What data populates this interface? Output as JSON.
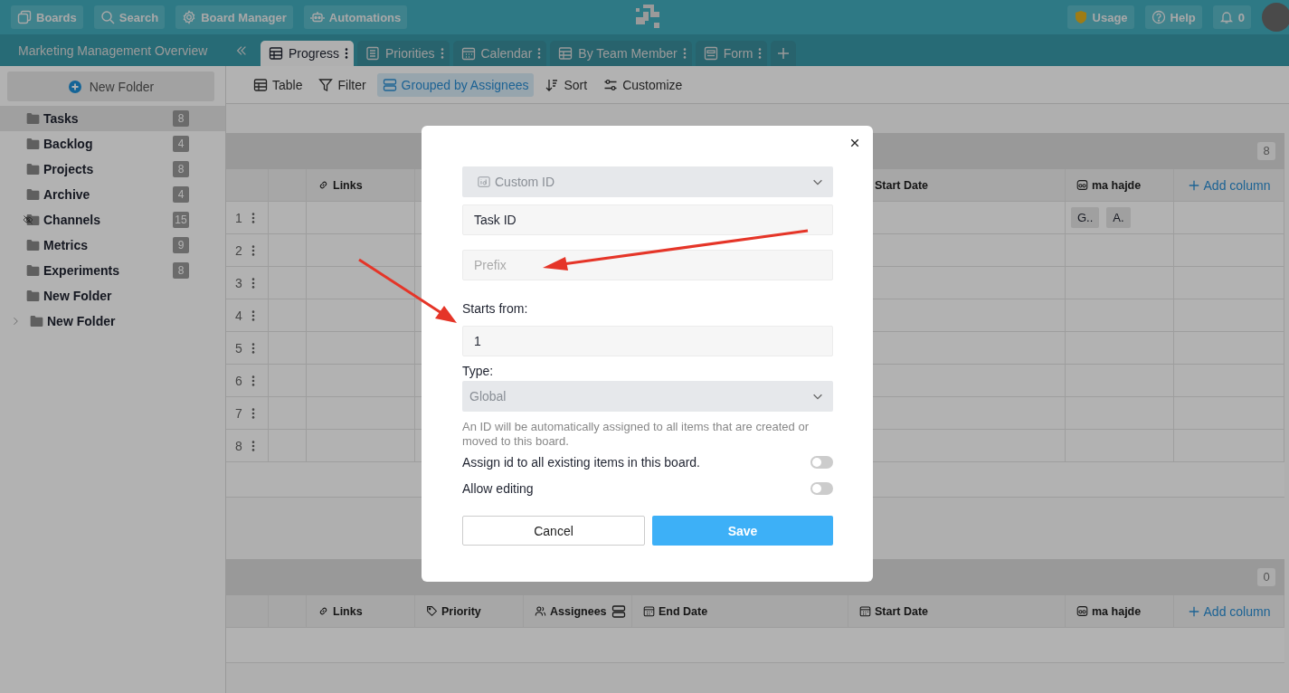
{
  "top_bar": {
    "nav": [
      {
        "kind": "boards",
        "label": "Boards"
      },
      {
        "kind": "search",
        "label": "Search"
      },
      {
        "kind": "gear",
        "label": "Board Manager"
      },
      {
        "kind": "robot",
        "label": "Automations"
      }
    ],
    "right": [
      {
        "kind": "shield",
        "label": "Usage"
      },
      {
        "kind": "help",
        "label": "Help"
      },
      {
        "kind": "bell",
        "label": "0"
      }
    ]
  },
  "board_title": "Marketing Management Overview",
  "tabs": [
    {
      "kind": "table",
      "label": "Progress",
      "selected": true
    },
    {
      "kind": "list",
      "label": "Priorities",
      "selected": false
    },
    {
      "kind": "calendar",
      "label": "Calendar",
      "selected": false
    },
    {
      "kind": "table",
      "label": "By Team Member",
      "selected": false
    },
    {
      "kind": "form",
      "label": "Form",
      "selected": false
    }
  ],
  "sidebar": {
    "new_folder": "New Folder",
    "items": [
      {
        "label": "Tasks",
        "count": "8",
        "selected": true,
        "hidden": false
      },
      {
        "label": "Backlog",
        "count": "4",
        "selected": false,
        "hidden": false
      },
      {
        "label": "Projects",
        "count": "8",
        "selected": false,
        "hidden": false
      },
      {
        "label": "Archive",
        "count": "4",
        "selected": false,
        "hidden": false
      },
      {
        "label": "Channels",
        "count": "15",
        "selected": false,
        "hidden": true
      },
      {
        "label": "Metrics",
        "count": "9",
        "selected": false,
        "hidden": false
      },
      {
        "label": "Experiments",
        "count": "8",
        "selected": false,
        "hidden": false
      },
      {
        "label": "New Folder",
        "selected": false,
        "hidden": false
      },
      {
        "label": "New Folder",
        "selected": false,
        "hidden": false,
        "expanded": false
      }
    ]
  },
  "toolbar": [
    {
      "kind": "table",
      "label": "Table",
      "selected": false
    },
    {
      "kind": "filter",
      "label": "Filter",
      "selected": false
    },
    {
      "kind": "group",
      "label": "Grouped by Assignees",
      "selected": true
    },
    {
      "kind": "sort",
      "label": "Sort",
      "selected": false
    },
    {
      "kind": "customize",
      "label": "Customize",
      "selected": false
    }
  ],
  "groups": [
    {
      "count": "8",
      "columns": [
        {
          "kind": "link",
          "label": "Links",
          "grouped": false
        },
        {
          "kind": "covered"
        },
        {
          "kind": "covered"
        },
        {
          "kind": "covered"
        },
        {
          "kind": "date",
          "label": "Start Date",
          "grouped": false
        },
        {
          "kind": "ai",
          "label": "ma hajde",
          "grouped": false
        },
        {
          "kind": "add",
          "label": "Add column",
          "grouped": false
        }
      ],
      "rows": [
        {
          "number": "1",
          "ma_hajde": [
            "G..",
            "A."
          ]
        },
        {
          "number": "2"
        },
        {
          "number": "3"
        },
        {
          "number": "4"
        },
        {
          "number": "5"
        },
        {
          "number": "6"
        },
        {
          "number": "7"
        },
        {
          "number": "8"
        }
      ]
    },
    {
      "count": "0",
      "columns": [
        {
          "kind": "link",
          "label": "Links",
          "grouped": false
        },
        {
          "kind": "tag",
          "label": "Priority",
          "grouped": false
        },
        {
          "kind": "people",
          "label": "Assignees",
          "grouped": true
        },
        {
          "kind": "date",
          "label": "End Date",
          "grouped": false
        },
        {
          "kind": "date",
          "label": "Start Date",
          "grouped": false
        },
        {
          "kind": "ai",
          "label": "ma hajde",
          "grouped": false
        },
        {
          "kind": "add",
          "label": "Add column",
          "grouped": false
        }
      ]
    }
  ],
  "modal": {
    "field_type": "Custom ID",
    "name_value": "Task ID",
    "prefix_placeholder": "Prefix",
    "starts_label": "Starts from:",
    "starts_value": "1",
    "type_label": "Type:",
    "type_value": "Global",
    "help": "An ID will be automatically assigned to all items that are created or moved to this board.",
    "toggles": [
      {
        "label": "Assign id to all existing items in this board.",
        "checked": false
      },
      {
        "label": "Allow editing",
        "checked": false
      }
    ],
    "cancel": "Cancel",
    "save": "Save"
  }
}
